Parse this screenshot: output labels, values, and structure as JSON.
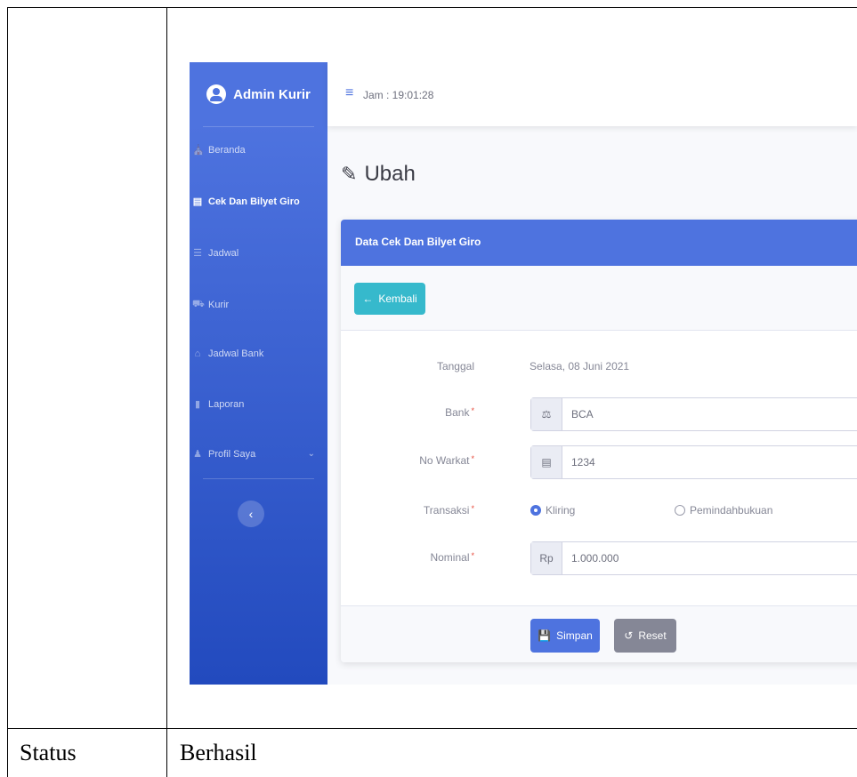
{
  "app": {
    "brand": "Admin Kurir",
    "clock": "Jam : 19:01:28"
  },
  "sidebar": {
    "items": [
      {
        "label": "Beranda",
        "icon": "home-icon"
      },
      {
        "label": "Cek Dan Bilyet Giro",
        "icon": "card-icon",
        "active": true
      },
      {
        "label": "Jadwal",
        "icon": "list-icon"
      },
      {
        "label": "Kurir",
        "icon": "truck-icon"
      },
      {
        "label": "Jadwal Bank",
        "icon": "bank-icon"
      },
      {
        "label": "Laporan",
        "icon": "folder-icon"
      },
      {
        "label": "Profil Saya",
        "icon": "user-icon"
      }
    ]
  },
  "page": {
    "title": "Ubah"
  },
  "card": {
    "header": "Data Cek Dan Bilyet Giro",
    "back_label": "Kembali",
    "form": {
      "tanggal_label": "Tanggal",
      "tanggal_value": "Selasa, 08 Juni 2021",
      "bank_label": "Bank",
      "bank_value": "BCA",
      "warkat_label": "No Warkat",
      "warkat_value": "1234",
      "transaksi_label": "Transaksi",
      "transaksi_options": [
        "Kliring",
        "Pemindahbukuan"
      ],
      "transaksi_selected": "Kliring",
      "nominal_label": "Nominal",
      "nominal_prefix": "Rp",
      "nominal_value": "1.000.000",
      "required_mark": "*"
    },
    "save_label": "Simpan",
    "reset_label": "Reset"
  },
  "doc": {
    "status_label": "Status",
    "status_value": "Berhasil"
  },
  "colors": {
    "primary": "#4e73df",
    "info": "#36b9cc",
    "secondary": "#858796",
    "danger": "#e74a3b"
  }
}
